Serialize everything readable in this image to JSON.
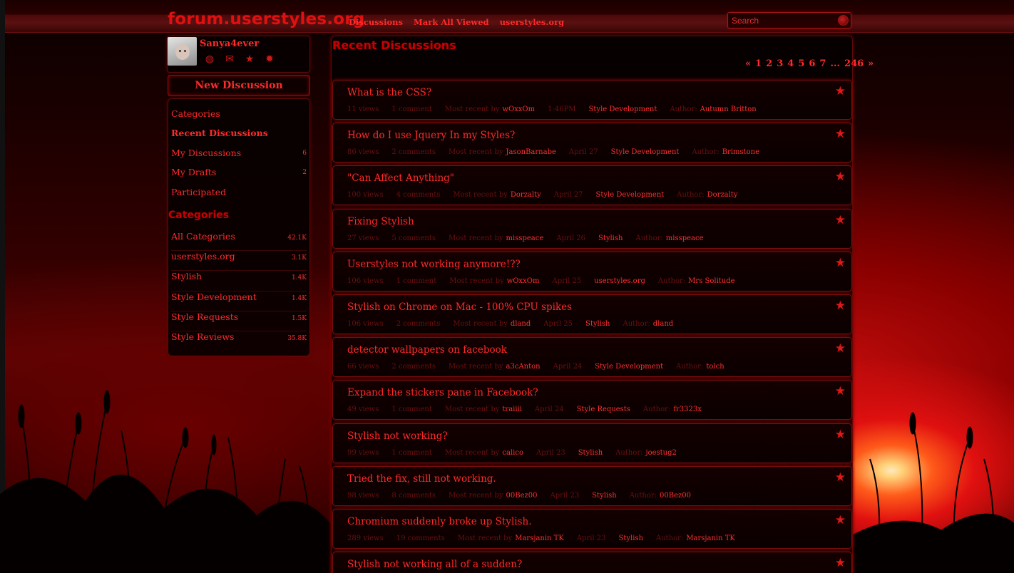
{
  "site": {
    "logo": "forum.userstyles.org"
  },
  "topnav": [
    {
      "label": "Discussions"
    },
    {
      "label": "Mark All Viewed"
    },
    {
      "label": "userstyles.org"
    }
  ],
  "search": {
    "placeholder": "Search"
  },
  "user": {
    "name": "Sanya4ever"
  },
  "new_discussion_label": "New Discussion",
  "nav": [
    {
      "label": "Categories",
      "count": ""
    },
    {
      "label": "Recent Discussions",
      "count": ""
    },
    {
      "label": "My Discussions",
      "count": "6"
    },
    {
      "label": "My Drafts",
      "count": "2"
    },
    {
      "label": "Participated",
      "count": ""
    }
  ],
  "categories_heading": "Categories",
  "categories": [
    {
      "label": "All Categories",
      "count": "42.1K"
    },
    {
      "label": "userstyles.org",
      "count": "3.1K"
    },
    {
      "label": "Stylish",
      "count": "1.4K"
    },
    {
      "label": "Style Development",
      "count": "1.4K"
    },
    {
      "label": "Style Requests",
      "count": "1.5K"
    },
    {
      "label": "Style Reviews",
      "count": "35.8K"
    }
  ],
  "main_heading": "Recent Discussions",
  "pager": {
    "prev": "«",
    "pages": [
      "1",
      "2",
      "3",
      "4",
      "5",
      "6",
      "7"
    ],
    "ellipsis": "...",
    "last": "246",
    "next": "»"
  },
  "discussions": [
    {
      "title": "What is the CSS?",
      "views": "11 views",
      "comments": "1 comment",
      "recent_label": "Most recent by",
      "recent_by": "wOxxOm",
      "date": "1:46PM",
      "category": "Style Development",
      "author_label": "Author:",
      "author": "Autumn Britton"
    },
    {
      "title": "How do I use Jquery In my Styles?",
      "views": "86 views",
      "comments": "2 comments",
      "recent_label": "Most recent by",
      "recent_by": "JasonBarnabe",
      "date": "April 27",
      "category": "Style Development",
      "author_label": "Author:",
      "author": "Brimstone"
    },
    {
      "title": "\"Can Affect Anything\"",
      "views": "100 views",
      "comments": "4 comments",
      "recent_label": "Most recent by",
      "recent_by": "Dorzalty",
      "date": "April 27",
      "category": "Style Development",
      "author_label": "Author:",
      "author": "Dorzalty"
    },
    {
      "title": "Fixing Stylish",
      "views": "27 views",
      "comments": "5 comments",
      "recent_label": "Most recent by",
      "recent_by": "misspeace",
      "date": "April 26",
      "category": "Stylish",
      "author_label": "Author:",
      "author": "misspeace"
    },
    {
      "title": "Userstyles not working anymore!??",
      "views": "106 views",
      "comments": "1 comment",
      "recent_label": "Most recent by",
      "recent_by": "wOxxOm",
      "date": "April 25",
      "category": "userstyles.org",
      "author_label": "Author:",
      "author": "Mrs Solitude"
    },
    {
      "title": "Stylish on Chrome on Mac - 100% CPU spikes",
      "views": "106 views",
      "comments": "2 comments",
      "recent_label": "Most recent by",
      "recent_by": "dland",
      "date": "April 25",
      "category": "Stylish",
      "author_label": "Author:",
      "author": "dland"
    },
    {
      "title": "detector wallpapers on facebook",
      "views": "66 views",
      "comments": "2 comments",
      "recent_label": "Most recent by",
      "recent_by": "a3cAnton",
      "date": "April 24",
      "category": "Style Development",
      "author_label": "Author:",
      "author": "tolch"
    },
    {
      "title": "Expand the stickers pane in Facebook?",
      "views": "49 views",
      "comments": "1 comment",
      "recent_label": "Most recent by",
      "recent_by": "traiiii",
      "date": "April 24",
      "category": "Style Requests",
      "author_label": "Author:",
      "author": "fr3323x"
    },
    {
      "title": "Stylish not working?",
      "views": "99 views",
      "comments": "1 comment",
      "recent_label": "Most recent by",
      "recent_by": "calico",
      "date": "April 23",
      "category": "Stylish",
      "author_label": "Author:",
      "author": "joestug2"
    },
    {
      "title": "Tried the fix, still not working.",
      "views": "98 views",
      "comments": "8 comments",
      "recent_label": "Most recent by",
      "recent_by": "00Bez00",
      "date": "April 23",
      "category": "Stylish",
      "author_label": "Author:",
      "author": "00Bez00"
    },
    {
      "title": "Chromium suddenly broke up Stylish.",
      "views": "289 views",
      "comments": "19 comments",
      "recent_label": "Most recent by",
      "recent_by": "Marsjanin TK",
      "date": "April 23",
      "category": "Stylish",
      "author_label": "Author:",
      "author": "Marsjanin TK"
    },
    {
      "title": "Stylish not working all of a sudden?",
      "views": "",
      "comments": "",
      "recent_label": "",
      "recent_by": "",
      "date": "",
      "category": "",
      "author_label": "",
      "author": ""
    }
  ],
  "colors": {
    "accent": "#ff2a2a",
    "heading": "#c80000",
    "border": "#7a0e0e",
    "muted": "#6a1010"
  }
}
